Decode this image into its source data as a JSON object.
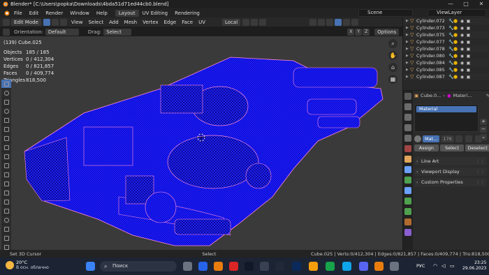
{
  "window": {
    "title": "Blender* [C:\\Users\\popka\\Downloads\\4bda51d71ed44cb0.blend]",
    "minimize": "—",
    "maximize": "□",
    "close": "✕"
  },
  "menu": {
    "items": [
      "File",
      "Edit",
      "Render",
      "Window",
      "Help"
    ],
    "workspaces": [
      "Layout",
      "UV Editing",
      "Rendering"
    ],
    "active_workspace": "Layout"
  },
  "scene": {
    "scene_name": "Scene",
    "view_layer": "ViewLayer"
  },
  "viewport_header": {
    "mode": "Edit Mode",
    "menus": [
      "View",
      "Select",
      "Add",
      "Mesh",
      "Vertex",
      "Edge",
      "Face",
      "UV"
    ],
    "transform_orientation": "Local",
    "orientation_label": "Orientation:",
    "orientation_value": "Default",
    "drag_label": "Drag:",
    "drag_value": "Select Box",
    "axes": [
      "X",
      "Y",
      "Z"
    ],
    "options": "Options"
  },
  "stats": {
    "header": "(139) Cube.025",
    "rows": [
      {
        "k": "Objects",
        "v": "185 / 185"
      },
      {
        "k": "Vertices",
        "v": "0 / 412,304"
      },
      {
        "k": "Edges",
        "v": "0 / 821,857"
      },
      {
        "k": "Faces",
        "v": "0 / 409,774"
      },
      {
        "k": "Triangles",
        "v": "818,500"
      }
    ]
  },
  "outliner": {
    "rows": [
      "Cylinder.072",
      "Cylinder.073",
      "Cylinder.075",
      "Cylinder.077",
      "Cylinder.078",
      "Cylinder.080",
      "Cylinder.084",
      "Cylinder.085",
      "Cylinder.087"
    ]
  },
  "properties": {
    "object": "Cube.0...",
    "material_path": "Materi...",
    "slot": "Material",
    "material_name": "Mat...",
    "user_count": "176",
    "buttons": [
      "Assign",
      "Select",
      "Deselect"
    ],
    "panels": [
      "Line Art",
      "Viewport Display",
      "Custom Properties"
    ]
  },
  "status": {
    "left": "Set 3D Cursor",
    "middle": "Select",
    "right": "Cube.025 | Verts:0/412,304 | Edges:0/821,857 | Faces:0/409,774 | Tris:818,500 | Objec"
  },
  "taskbar": {
    "temp": "20°C",
    "weather": "В осн. облачно",
    "search": "Поиск",
    "lang": "РУС",
    "time": "23:25",
    "date": "29.06.2023"
  },
  "colors": {
    "accent": "#4772b3",
    "mesh_blue": "#1a1aff",
    "mesh_edge": "#ff7ad9"
  }
}
